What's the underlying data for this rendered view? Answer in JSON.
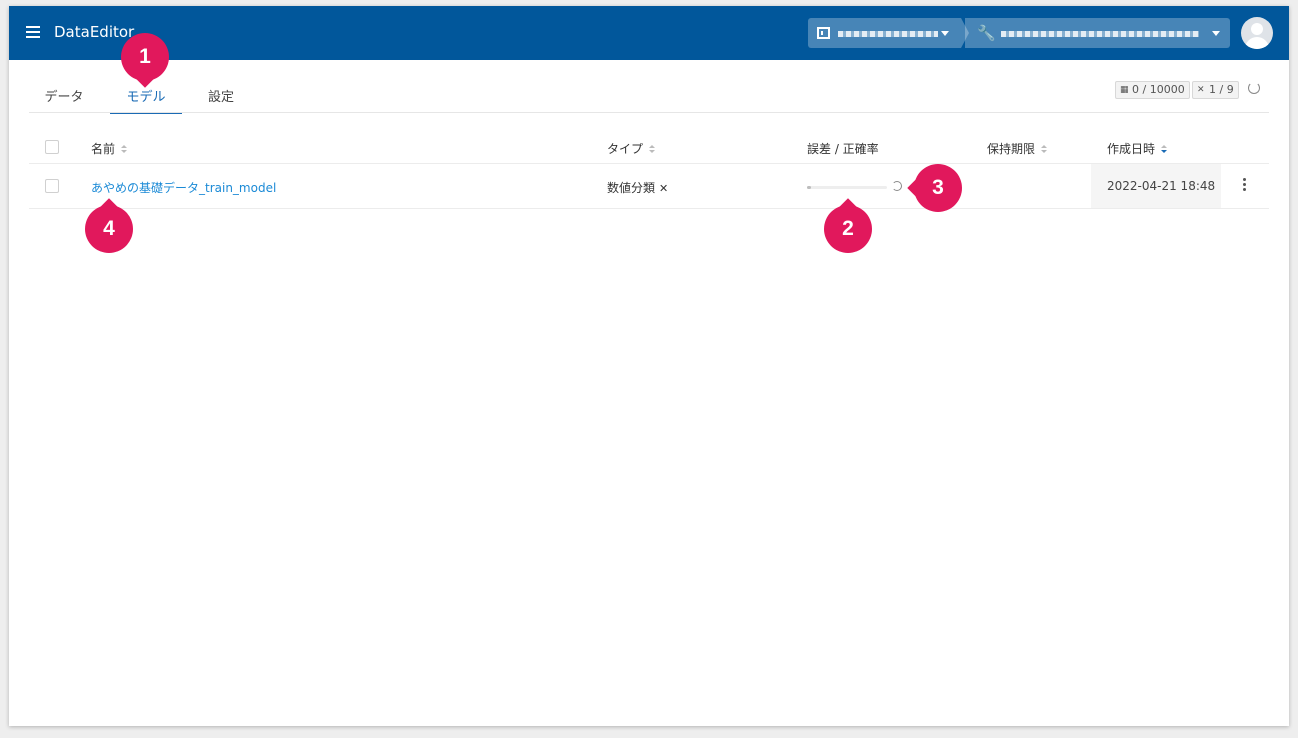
{
  "header": {
    "app_title": "DataEditor",
    "background_color": "#01579b"
  },
  "tabs": [
    {
      "label": "データ",
      "active": false
    },
    {
      "label": "モデル",
      "active": true
    },
    {
      "label": "設定",
      "active": false
    }
  ],
  "counters": {
    "table_count": "0 / 10000",
    "model_count": "1 / 9"
  },
  "table": {
    "columns": {
      "name": "名前",
      "type": "タイプ",
      "accuracy": "誤差 / 正確率",
      "retention": "保持期限",
      "created": "作成日時"
    },
    "rows": [
      {
        "name": "あやめの基礎データ_train_model",
        "type": "数値分類",
        "progress": 0.05,
        "retention": "",
        "created": "2022-04-21 18:48"
      }
    ]
  },
  "callouts": [
    "1",
    "2",
    "3",
    "4"
  ],
  "accent_color": "#e1185c",
  "link_color": "#1b8ad6"
}
